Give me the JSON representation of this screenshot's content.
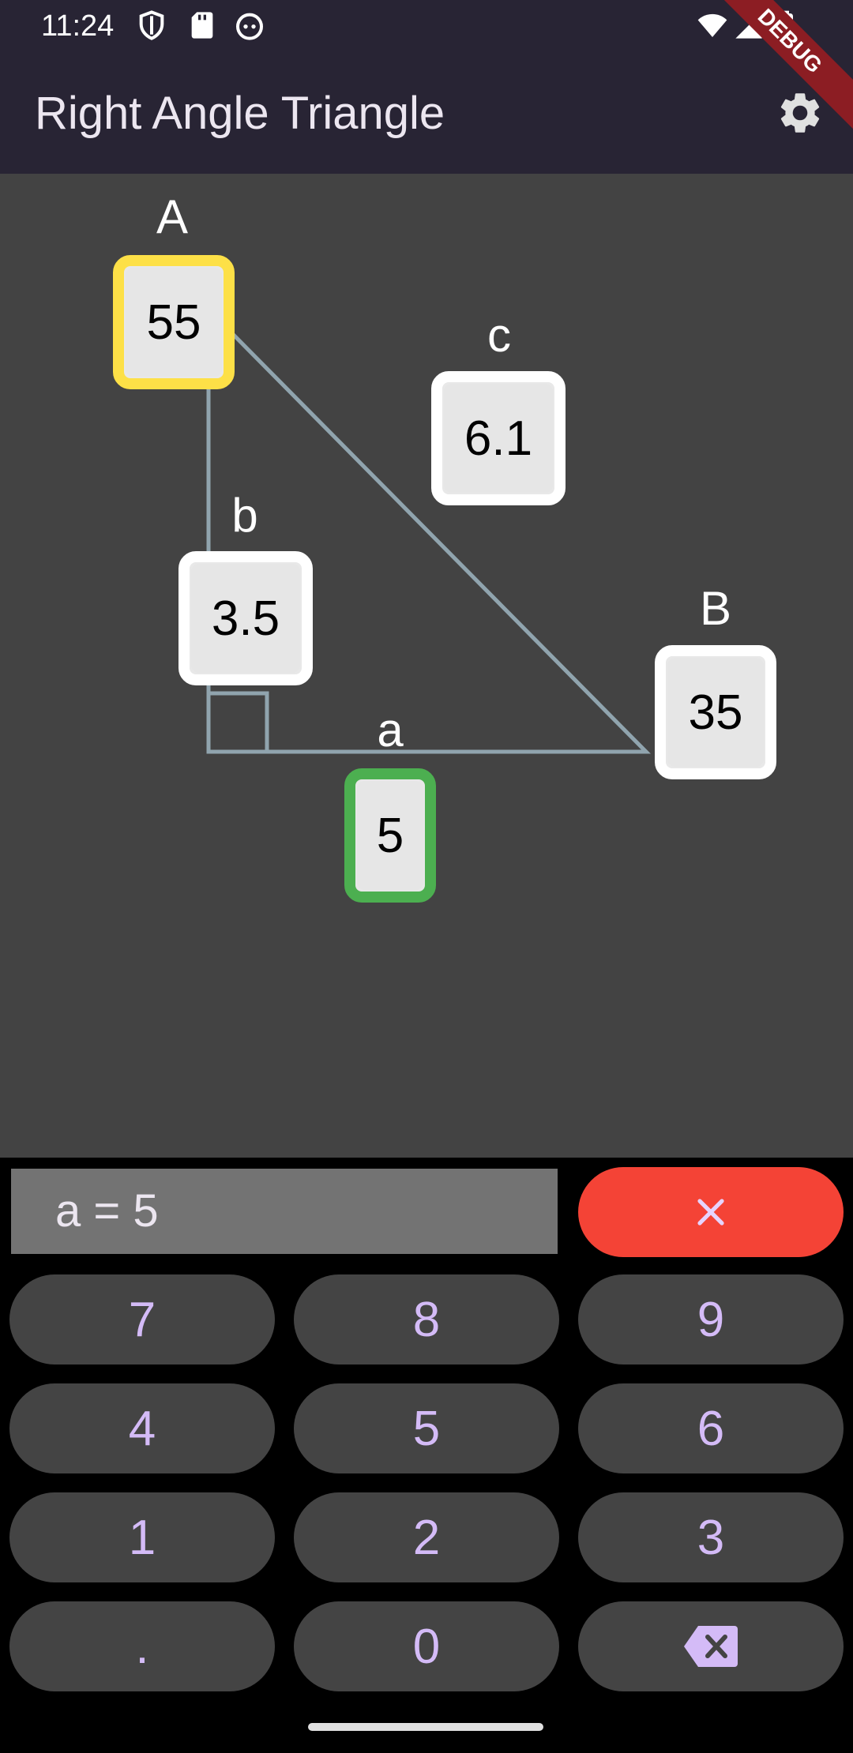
{
  "status_bar": {
    "time": "11:24",
    "left_icons": [
      "shield-icon",
      "sd-card-icon",
      "android-icon"
    ],
    "right_icons": [
      "wifi-icon",
      "signal-icon",
      "battery-icon"
    ]
  },
  "app_bar": {
    "title": "Right Angle Triangle",
    "settings_icon": "gear-icon",
    "debug_banner": "DEBUG"
  },
  "triangle": {
    "angle_A": {
      "label": "A",
      "value": "55",
      "highlight": "#fde047"
    },
    "angle_B": {
      "label": "B",
      "value": "35",
      "highlight": "#ffffff"
    },
    "side_a": {
      "label": "a",
      "value": "5",
      "highlight": "#4caf50"
    },
    "side_b": {
      "label": "b",
      "value": "3.5",
      "highlight": "#ffffff"
    },
    "side_c": {
      "label": "c",
      "value": "6.1",
      "highlight": "#ffffff"
    }
  },
  "keypad": {
    "display": "a = 5",
    "clear_icon": "close-icon",
    "keys": [
      "7",
      "8",
      "9",
      "4",
      "5",
      "6",
      "1",
      "2",
      "3",
      ".",
      "0"
    ],
    "backspace_icon": "backspace-icon"
  },
  "colors": {
    "app_bar": "#282434",
    "canvas": "#434343",
    "triangle_line": "#90a4ae",
    "key_bg": "#444444",
    "key_text": "#d4bbf7",
    "clear_bg": "#f44336"
  }
}
